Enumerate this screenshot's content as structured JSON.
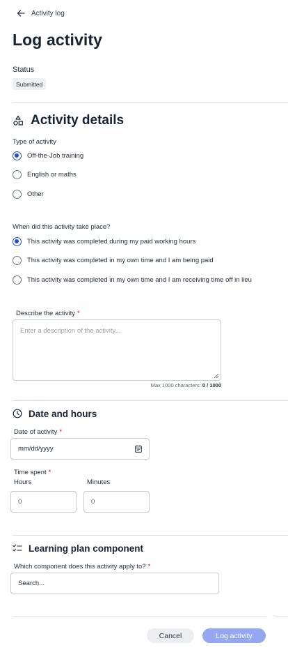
{
  "header": {
    "back_label": "Activity log",
    "title": "Log activity"
  },
  "status": {
    "label": "Status",
    "value": "Submitted"
  },
  "activity_details": {
    "title": "Activity details",
    "icon": "shapes-icon",
    "type": {
      "label": "Type of activity",
      "options": [
        "Off-the-Job training",
        "English or maths",
        "Other"
      ],
      "selected_index": 0
    },
    "when": {
      "label": "When did this activity take place?",
      "options": [
        "This activity was completed during my paid working hours",
        "This activity was completed in my own time and I am being paid",
        "This activity was completed in my own time and I am receiving time off in lieu"
      ],
      "selected_index": 0
    },
    "description": {
      "label": "Describe the activity",
      "required_mark": "*",
      "placeholder": "Enter a description of the activity...",
      "max_prefix": "Max 1000 characters:",
      "count": "0 / 1000"
    }
  },
  "date_hours": {
    "title": "Date and hours",
    "icon": "clock-icon",
    "date_label": "Date of activity",
    "required_mark": "*",
    "date_placeholder": "mm/dd/yyyy",
    "time_label": "Time spent",
    "hours_label": "Hours",
    "hours_value": "0",
    "minutes_label": "Minutes",
    "minutes_value": "0"
  },
  "learning_plan": {
    "title": "Learning plan component",
    "icon": "checklist-icon",
    "question": "Which component does this activity apply to?",
    "required_mark": "*",
    "search_placeholder": "Search..."
  },
  "footer": {
    "cancel_label": "Cancel",
    "submit_label": "Log activity"
  },
  "colors": {
    "primary": "#1d4fd8",
    "primary_disabled": "#93a8f0",
    "required": "#c8102e"
  }
}
